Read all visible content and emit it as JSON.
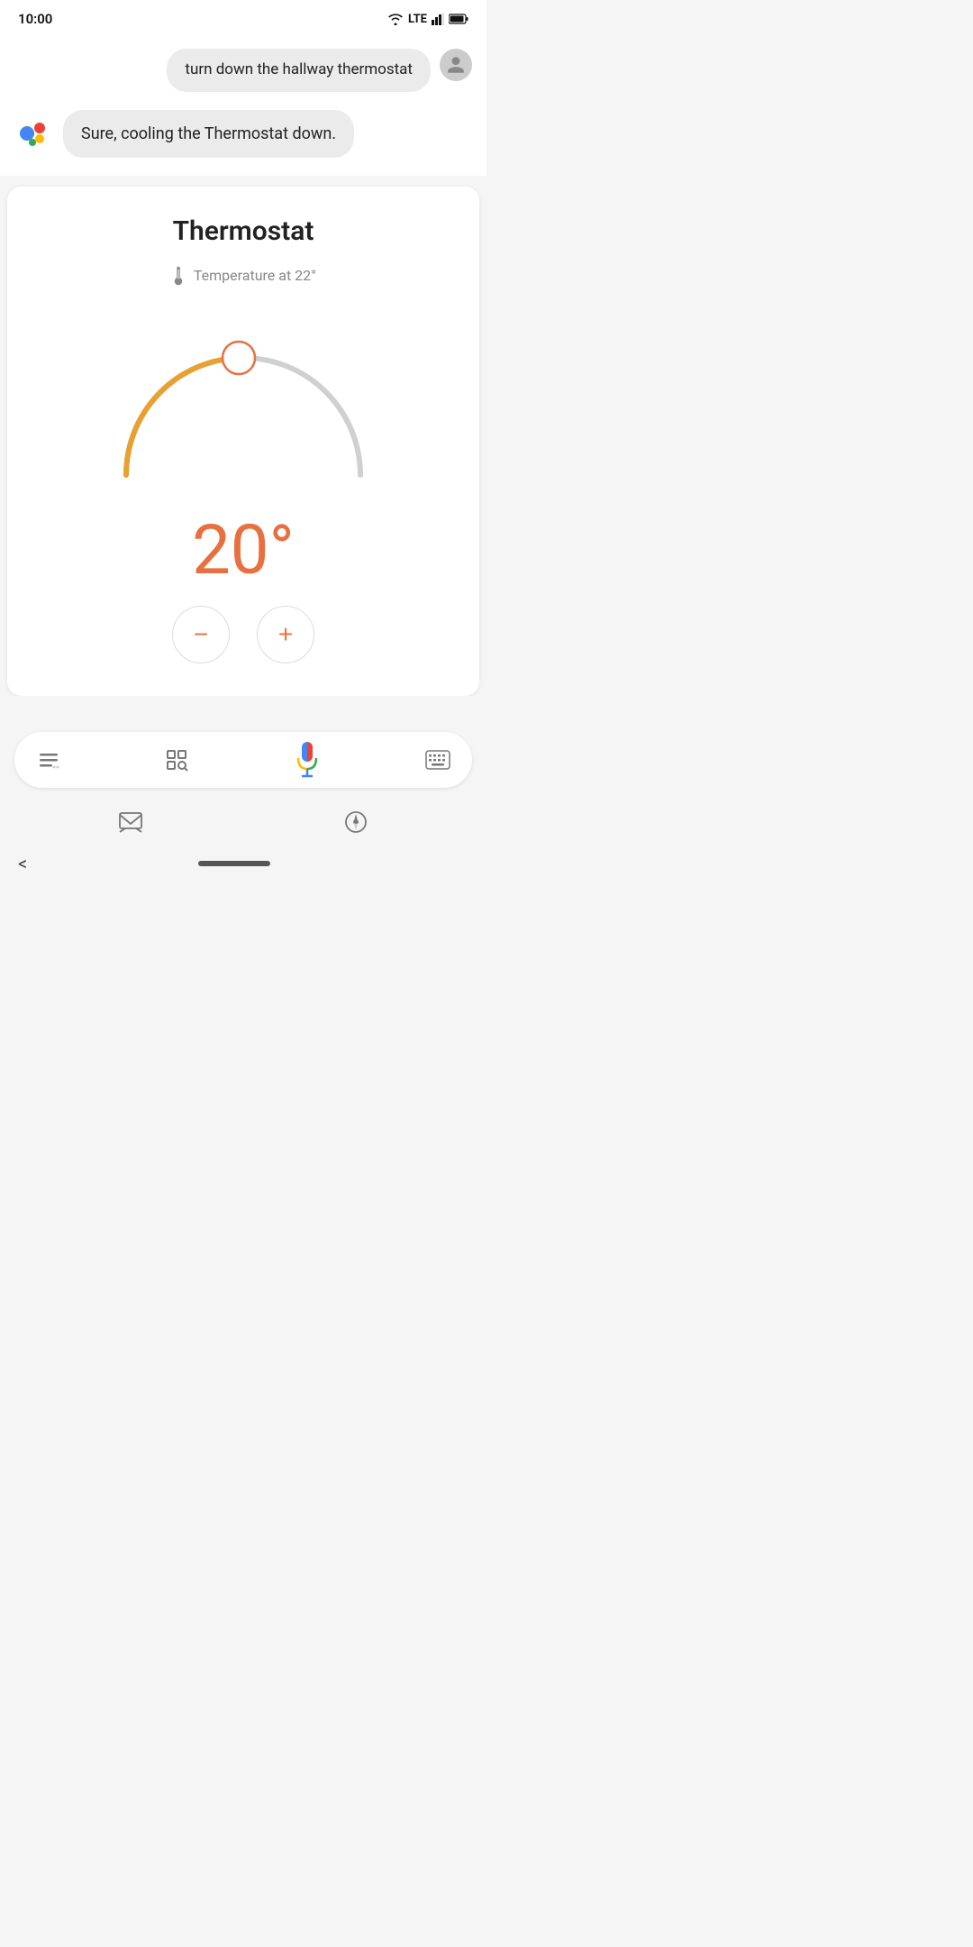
{
  "statusBar": {
    "time": "10:00",
    "network": "LTE"
  },
  "chat": {
    "userMessage": "turn down the hallway thermostat",
    "assistantMessage": "Sure, cooling the Thermostat down."
  },
  "thermostat": {
    "title": "Thermostat",
    "tempLabel": "Temperature at 22°",
    "currentTemp": "20°",
    "accentColor": "#E87040",
    "arcActiveColor": "#E8A030",
    "arcInactiveColor": "#ccc",
    "minusLabel": "−",
    "plusLabel": "+"
  },
  "inputBar": {
    "scanIcon": "scan-icon",
    "micIcon": "mic-icon",
    "keyboardIcon": "keyboard-icon"
  },
  "nav": {
    "menuIcon": "menu-icon",
    "compassIcon": "compass-icon"
  },
  "footer": {
    "backLabel": "<",
    "homePill": "home-pill"
  }
}
